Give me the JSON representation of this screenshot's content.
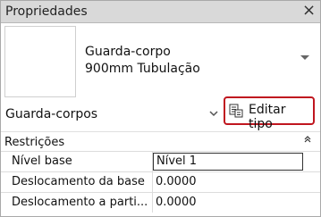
{
  "window": {
    "title": "Propriedades",
    "close_glyph": "×"
  },
  "type_selector": {
    "line1": "Guarda-corpo",
    "line2": "900mm Tubulação"
  },
  "family": {
    "label": "Guarda-corpos",
    "edit_type_label": "Editar tipo"
  },
  "sections": {
    "constraints_label": "Restrições"
  },
  "properties": [
    {
      "name": "Nível base",
      "value": "Nível 1"
    },
    {
      "name": "Deslocamento da base",
      "value": "0.0000"
    },
    {
      "name": "Deslocamento a partir do caminho",
      "value": "0.0000"
    }
  ],
  "colors": {
    "highlight": "#c0161f",
    "titlebar": "#d9d9d9"
  }
}
